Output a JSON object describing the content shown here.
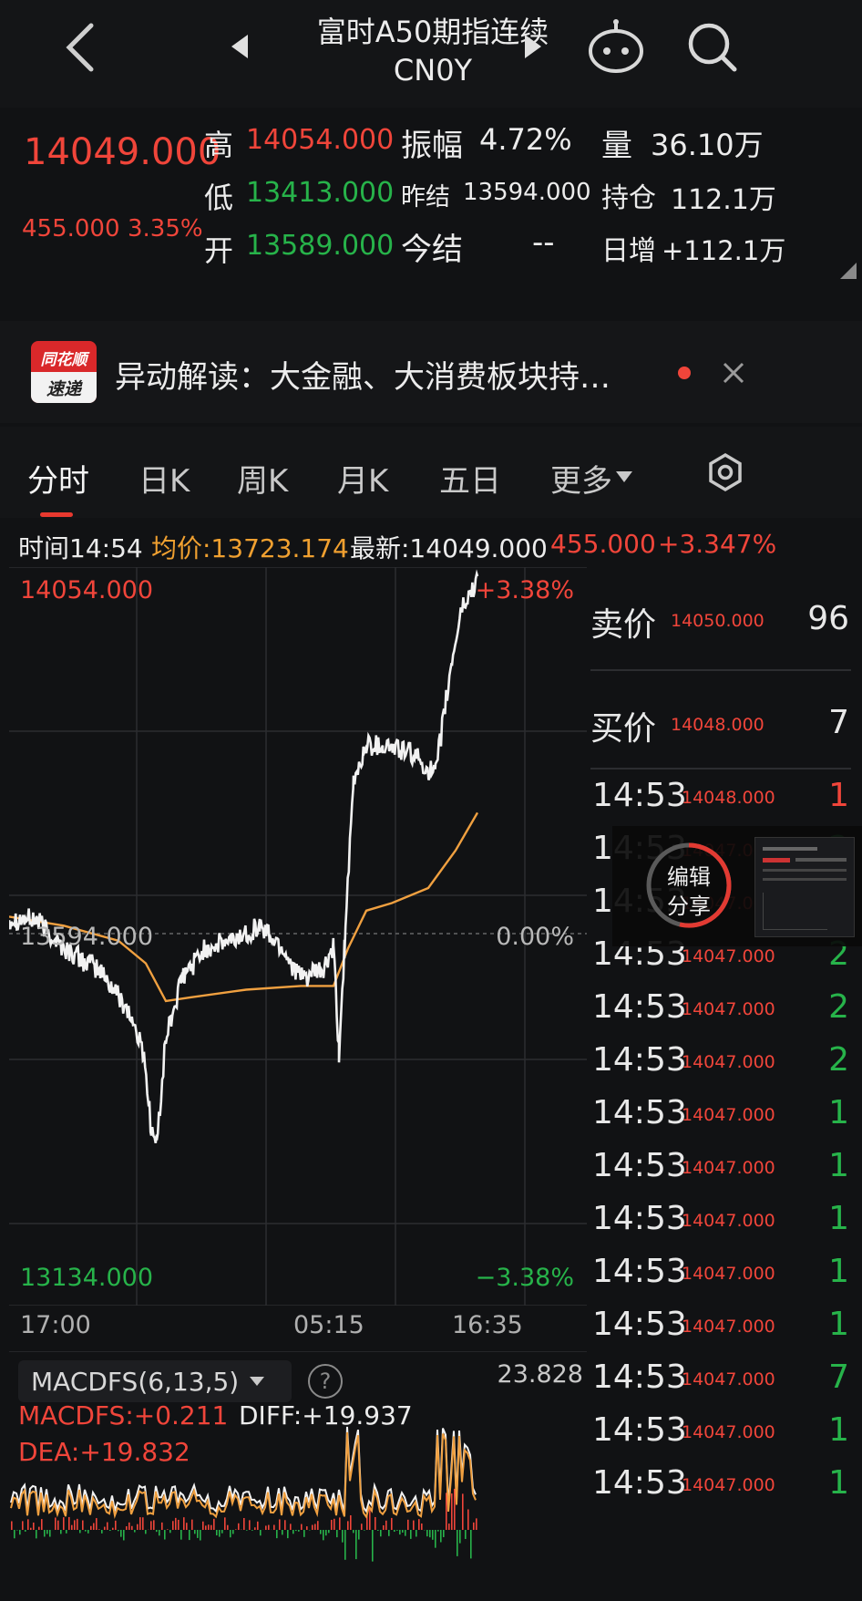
{
  "header": {
    "title": "富时A50期指连续",
    "code": "CN0Y"
  },
  "quote": {
    "last": "14049.000",
    "change": "455.000",
    "change_pct": "3.35%",
    "high_label": "高",
    "high": "14054.000",
    "low_label": "低",
    "low": "13413.000",
    "open_label": "开",
    "open": "13589.000",
    "amp_label": "振幅",
    "amp": "4.72%",
    "prev_label": "昨结",
    "prev": "13594.000",
    "settle_label": "今结",
    "settle": "--",
    "vol_label": "量",
    "vol": "36.10万",
    "oi_label": "持仓",
    "oi": "112.1万",
    "inc_label": "日增",
    "inc": "+112.1万"
  },
  "news": {
    "logo_top": "同花顺",
    "logo_bottom": "速递",
    "text": "异动解读：大金融、大消费板块持…"
  },
  "tabs": [
    "分时",
    "日K",
    "周K",
    "月K",
    "五日",
    "更多"
  ],
  "info": {
    "time": "时间14:54",
    "avg": "均价:13723.174",
    "latest": "最新:14049.000",
    "chg": "455.000",
    "pct": "+3.347%"
  },
  "chart_labels": {
    "top_price": "14054.000",
    "top_pct": "+3.38%",
    "mid_price": "13594.000",
    "mid_pct": "0.00%",
    "bot_price": "13134.000",
    "bot_pct": "−3.38%",
    "x_ticks": [
      "17:00",
      "05:15",
      "16:35"
    ]
  },
  "macd": {
    "selector": "MACDFS(6,13,5)",
    "help": "?",
    "max": "23.828",
    "macdfs": "MACDFS:+0.211",
    "diff": "DIFF:+19.937",
    "dea": "DEA:+19.832"
  },
  "share": {
    "label_1": "编辑",
    "label_2": "分享"
  },
  "orderbook": {
    "ask_label": "卖价",
    "ask_price": "14050.000",
    "ask_vol": "96",
    "bid_label": "买价",
    "bid_price": "14048.000",
    "bid_vol": "7",
    "trades": [
      {
        "time": "14:53",
        "price": "14048.000",
        "vol": "1",
        "color": "#f0453a"
      },
      {
        "time": "14:53",
        "price": "14047.000",
        "vol": "2",
        "color": "#27b34a"
      },
      {
        "time": "14:53",
        "price": "14047.000",
        "vol": "2",
        "color": "#27b34a"
      },
      {
        "time": "14:53",
        "price": "14047.000",
        "vol": "2",
        "color": "#27b34a"
      },
      {
        "time": "14:53",
        "price": "14047.000",
        "vol": "2",
        "color": "#27b34a"
      },
      {
        "time": "14:53",
        "price": "14047.000",
        "vol": "2",
        "color": "#27b34a"
      },
      {
        "time": "14:53",
        "price": "14047.000",
        "vol": "1",
        "color": "#27b34a"
      },
      {
        "time": "14:53",
        "price": "14047.000",
        "vol": "1",
        "color": "#27b34a"
      },
      {
        "time": "14:53",
        "price": "14047.000",
        "vol": "1",
        "color": "#27b34a"
      },
      {
        "time": "14:53",
        "price": "14047.000",
        "vol": "1",
        "color": "#27b34a"
      },
      {
        "time": "14:53",
        "price": "14047.000",
        "vol": "1",
        "color": "#27b34a"
      },
      {
        "time": "14:53",
        "price": "14047.000",
        "vol": "7",
        "color": "#27b34a"
      },
      {
        "time": "14:53",
        "price": "14047.000",
        "vol": "1",
        "color": "#27b34a"
      },
      {
        "time": "14:53",
        "price": "14047.000",
        "vol": "1",
        "color": "#27b34a"
      }
    ]
  },
  "colors": {
    "up": "#f0453a",
    "down": "#27b34a",
    "avg_line": "#f0a040",
    "price_line": "#f2f2f2"
  }
}
